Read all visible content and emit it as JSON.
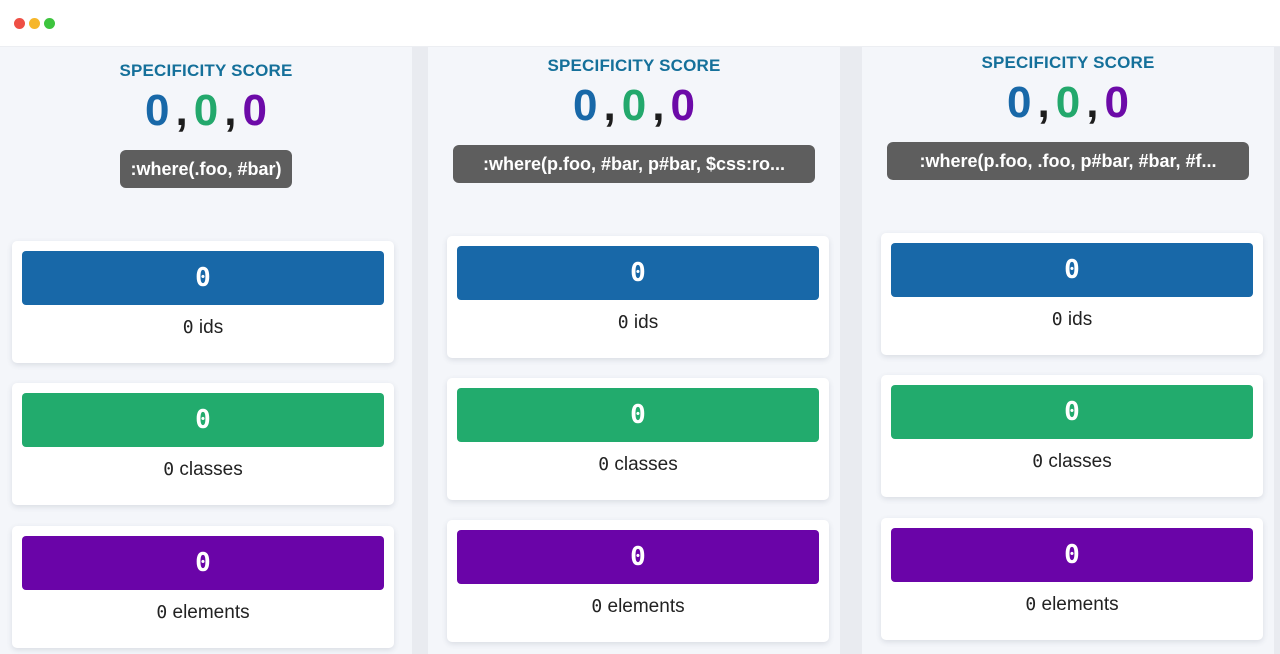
{
  "window": {
    "controls": [
      "close",
      "minimize",
      "zoom"
    ]
  },
  "panels": [
    {
      "score_label": "SPECIFICITY SCORE",
      "score": {
        "ids": "0",
        "classes": "0",
        "elements": "0",
        "separator": ","
      },
      "selector": ":where(.foo, #bar)",
      "cards": [
        {
          "value": "0",
          "count": "0",
          "label": "ids",
          "color": "#1868a8"
        },
        {
          "value": "0",
          "count": "0",
          "label": "classes",
          "color": "#22ab6d"
        },
        {
          "value": "0",
          "count": "0",
          "label": "elements",
          "color": "#6a04a8"
        }
      ]
    },
    {
      "score_label": "SPECIFICITY SCORE",
      "score": {
        "ids": "0",
        "classes": "0",
        "elements": "0",
        "separator": ","
      },
      "selector": ":where(p.foo, #bar, p#bar, $css:ro...",
      "cards": [
        {
          "value": "0",
          "count": "0",
          "label": "ids",
          "color": "#1868a8"
        },
        {
          "value": "0",
          "count": "0",
          "label": "classes",
          "color": "#22ab6d"
        },
        {
          "value": "0",
          "count": "0",
          "label": "elements",
          "color": "#6a04a8"
        }
      ]
    },
    {
      "score_label": "SPECIFICITY SCORE",
      "score": {
        "ids": "0",
        "classes": "0",
        "elements": "0",
        "separator": ","
      },
      "selector": ":where(p.foo, .foo, p#bar, #bar, #f...",
      "cards": [
        {
          "value": "0",
          "count": "0",
          "label": "ids",
          "color": "#1868a8"
        },
        {
          "value": "0",
          "count": "0",
          "label": "classes",
          "color": "#22ab6d"
        },
        {
          "value": "0",
          "count": "0",
          "label": "elements",
          "color": "#6a04a8"
        }
      ]
    }
  ]
}
